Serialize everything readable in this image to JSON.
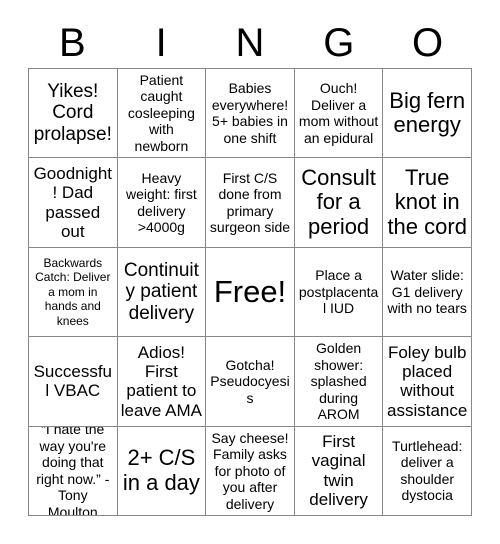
{
  "header": {
    "letters": [
      "B",
      "I",
      "N",
      "G",
      "O"
    ]
  },
  "grid": {
    "rows": 5,
    "columns": 5,
    "border_color": "#888888",
    "cell_background": "#ffffff",
    "text_color": "#000000",
    "cells": [
      {
        "text": "Yikes! Cord prolapse!",
        "size": "lg"
      },
      {
        "text": "Patient caught cosleeping with newborn",
        "size": "sm"
      },
      {
        "text": "Babies everywhere! 5+ babies in one shift",
        "size": "sm"
      },
      {
        "text": "Ouch! Deliver a mom without an epidural",
        "size": "sm"
      },
      {
        "text": "Big fern energy",
        "size": "xl"
      },
      {
        "text": "Goodnight! Dad passed out",
        "size": "md"
      },
      {
        "text": "Heavy weight: first delivery >4000g",
        "size": "sm"
      },
      {
        "text": "First C/S done from primary surgeon side",
        "size": "sm"
      },
      {
        "text": "Consult for a period",
        "size": "xl"
      },
      {
        "text": "True knot in the cord",
        "size": "xl"
      },
      {
        "text": "Backwards Catch: Deliver a mom in hands and knees",
        "size": "xs"
      },
      {
        "text": "Continuity patient delivery",
        "size": "lg"
      },
      {
        "text": "Free!",
        "size": "xxl"
      },
      {
        "text": "Place a postplacental IUD",
        "size": "sm"
      },
      {
        "text": "Water slide: G1 delivery with no tears",
        "size": "sm"
      },
      {
        "text": "Successful VBAC",
        "size": "md"
      },
      {
        "text": "Adios! First patient to leave AMA",
        "size": "md"
      },
      {
        "text": "Gotcha! Pseudocyesis",
        "size": "sm"
      },
      {
        "text": "Golden shower: splashed during AROM",
        "size": "sm"
      },
      {
        "text": "Foley bulb placed without assistance",
        "size": "md"
      },
      {
        "text": "“I hate the way you're doing that right now.” - Tony Moulton",
        "size": "sm"
      },
      {
        "text": "2+ C/S in a day",
        "size": "xl"
      },
      {
        "text": "Say cheese! Family asks for photo of you after delivery",
        "size": "sm"
      },
      {
        "text": "First vaginal twin delivery",
        "size": "md"
      },
      {
        "text": "Turtlehead: deliver a shoulder dystocia",
        "size": "sm"
      }
    ]
  }
}
